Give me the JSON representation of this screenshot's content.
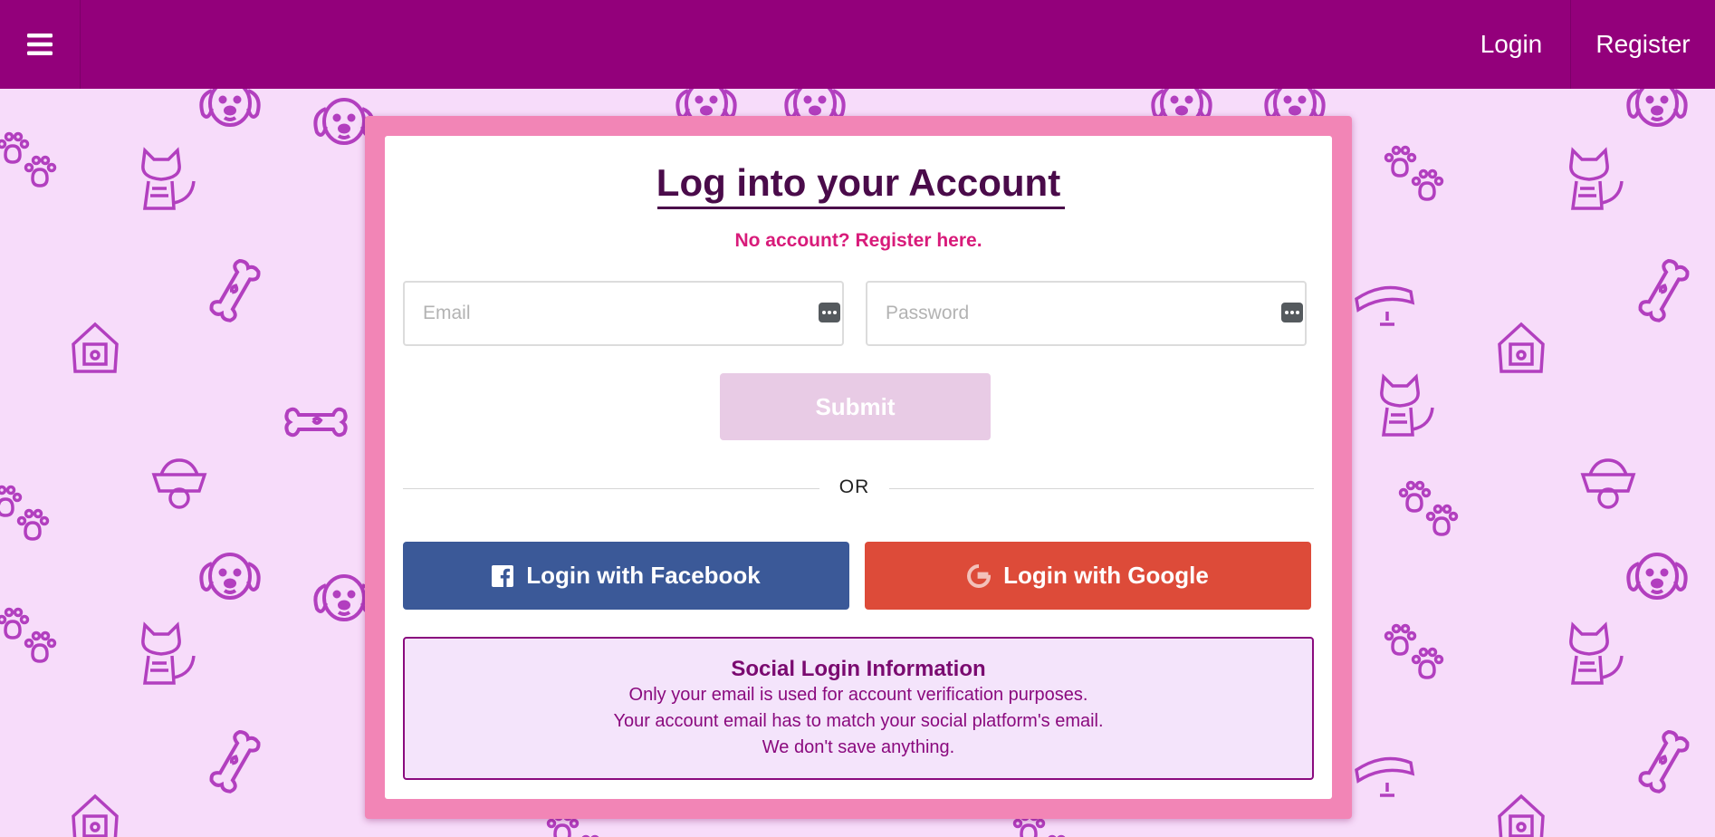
{
  "nav": {
    "menu_icon": "hamburger-menu-icon",
    "login_label": "Login",
    "register_label": "Register"
  },
  "login_form": {
    "title": "Log into your Account",
    "register_prompt": "No account? Register here.",
    "email_placeholder": "Email",
    "password_placeholder": "Password",
    "submit_label": "Submit",
    "divider_text": "OR",
    "facebook_label": "Login with Facebook",
    "google_label": "Login with Google"
  },
  "social_info": {
    "title": "Social Login Information",
    "lines": [
      "Only your email is used for account verification purposes.",
      "Your account email has to match your social platform's email.",
      "We don't save anything."
    ]
  },
  "colors": {
    "nav_background": "#93007b",
    "page_background": "#f7dcfa",
    "panel_frame": "#f285b6",
    "title_color": "#4a0b4a",
    "register_link": "#d81b7a",
    "submit_disabled": "#e8cbe5",
    "facebook": "#3b5998",
    "google": "#dd4b39",
    "info_accent": "#8a0a7e"
  },
  "icons": {
    "facebook": "facebook-icon",
    "google": "google-icon",
    "password_manager": "password-manager-icon",
    "pattern": [
      "dog-face-icon",
      "paw-print-icon",
      "cat-icon",
      "bone-icon",
      "dog-house-icon",
      "food-bowl-icon",
      "collar-icon"
    ]
  }
}
